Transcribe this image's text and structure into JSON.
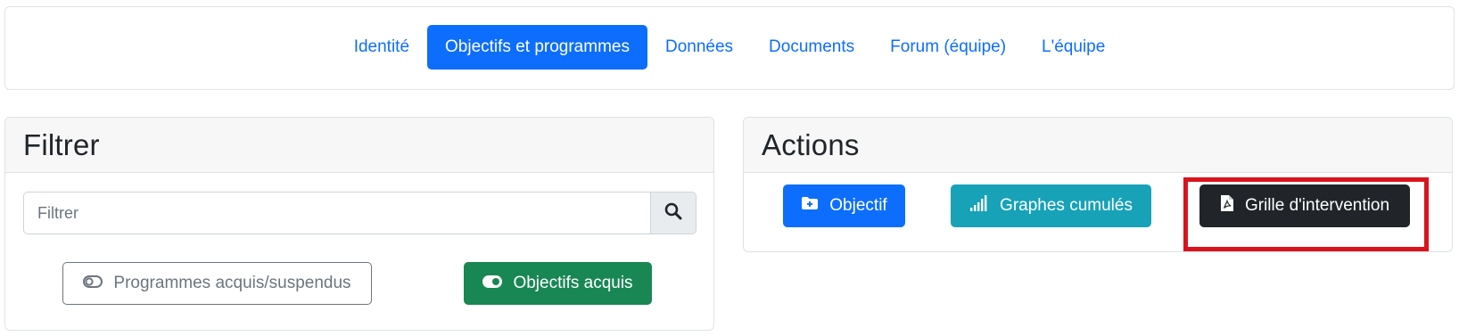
{
  "nav": {
    "items": [
      {
        "label": "Identité",
        "active": false
      },
      {
        "label": "Objectifs et programmes",
        "active": true
      },
      {
        "label": "Données",
        "active": false
      },
      {
        "label": "Documents",
        "active": false
      },
      {
        "label": "Forum (équipe)",
        "active": false
      },
      {
        "label": "L'équipe",
        "active": false
      }
    ]
  },
  "filter": {
    "title": "Filtrer",
    "search_placeholder": "Filtrer",
    "search_value": "",
    "search_icon": "search-icon",
    "toggle_programs_label": "Programmes acquis/suspendus",
    "toggle_programs_on": false,
    "toggle_objectives_label": "Objectifs acquis",
    "toggle_objectives_on": true
  },
  "actions": {
    "title": "Actions",
    "objective_label": "Objectif",
    "graphs_label": "Graphes cumulés",
    "grid_label": "Grille d'intervention"
  },
  "colors": {
    "primary": "#0d6efd",
    "success": "#198754",
    "info": "#17a2b8",
    "dark": "#212529",
    "highlight": "#d9141d"
  }
}
